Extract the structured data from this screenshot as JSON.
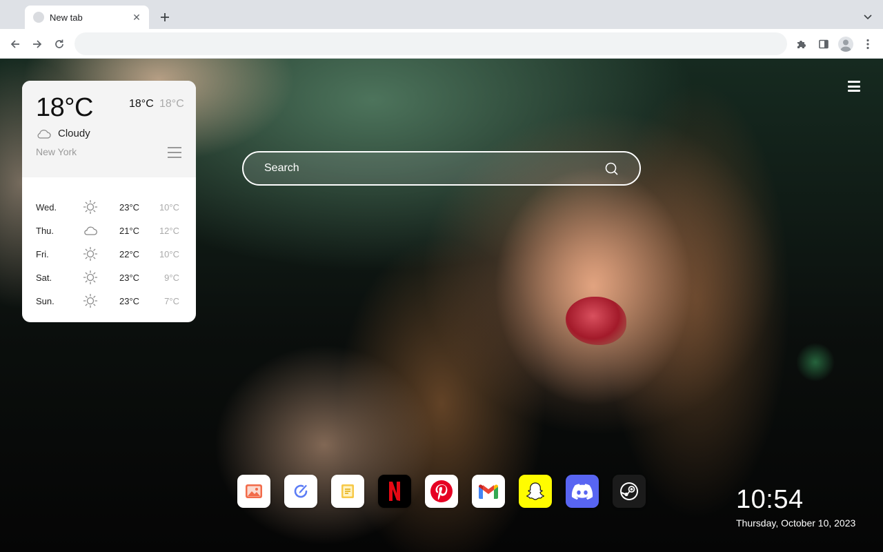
{
  "browser": {
    "tab_title": "New tab",
    "tab_close": "✕",
    "address_value": "",
    "address_placeholder": ""
  },
  "weather": {
    "current_temp": "18°C",
    "high": "18°C",
    "low": "18°C",
    "condition": "Cloudy",
    "city": "New York",
    "forecast": [
      {
        "day": "Wed.",
        "icon": "sun-icon",
        "high": "23°C",
        "low": "10°C"
      },
      {
        "day": "Thu.",
        "icon": "cloud-icon",
        "high": "21°C",
        "low": "12°C"
      },
      {
        "day": "Fri.",
        "icon": "sun-icon",
        "high": "22°C",
        "low": "10°C"
      },
      {
        "day": "Sat.",
        "icon": "sun-icon",
        "high": "23°C",
        "low": "9°C"
      },
      {
        "day": "Sun.",
        "icon": "sun-icon",
        "high": "23°C",
        "low": "7°C"
      }
    ]
  },
  "search": {
    "placeholder": "Search"
  },
  "dock": {
    "apps": [
      {
        "name": "photos",
        "icon": "photos-icon",
        "bg": "#ffffff"
      },
      {
        "name": "todo",
        "icon": "check-pen-icon",
        "bg": "#ffffff"
      },
      {
        "name": "notes",
        "icon": "notes-icon",
        "bg": "#ffffff"
      },
      {
        "name": "netflix",
        "icon": "netflix-icon",
        "bg": "#000000"
      },
      {
        "name": "pinterest",
        "icon": "pinterest-icon",
        "bg": "#ffffff"
      },
      {
        "name": "gmail",
        "icon": "gmail-icon",
        "bg": "#ffffff"
      },
      {
        "name": "snapchat",
        "icon": "snapchat-icon",
        "bg": "#fffc00"
      },
      {
        "name": "discord",
        "icon": "discord-icon",
        "bg": "#5865f2"
      },
      {
        "name": "steam",
        "icon": "steam-icon",
        "bg": "#1b1b1b"
      }
    ]
  },
  "clock": {
    "time": "10:54",
    "date": "Thursday, October 10, 2023"
  },
  "colors": {
    "netflix_red": "#e50914",
    "pinterest_red": "#e60023",
    "snapchat_yellow": "#fffc00",
    "discord_blurple": "#5865f2"
  }
}
